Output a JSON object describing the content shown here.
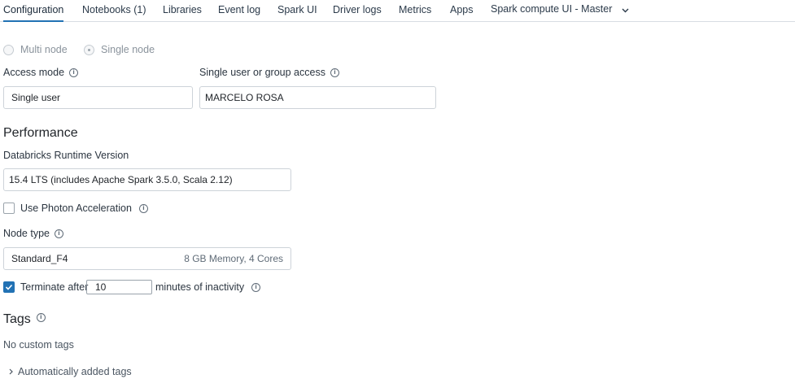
{
  "tabs": [
    {
      "label": "Configuration",
      "active": true
    },
    {
      "label": "Notebooks (1)"
    },
    {
      "label": "Libraries"
    },
    {
      "label": "Event log"
    },
    {
      "label": "Spark UI"
    },
    {
      "label": "Driver logs"
    },
    {
      "label": "Metrics"
    },
    {
      "label": "Apps"
    },
    {
      "label": "Spark compute UI - Master"
    }
  ],
  "node_mode": {
    "options": [
      "Multi node",
      "Single node"
    ],
    "selected": "Single node"
  },
  "access_mode": {
    "label": "Access mode",
    "value": "Single user"
  },
  "user_access": {
    "label": "Single user or group access",
    "value": "MARCELO ROSA"
  },
  "performance": {
    "title": "Performance",
    "runtime_label": "Databricks Runtime Version",
    "runtime_value": "15.4 LTS (includes Apache Spark 3.5.0, Scala 2.12)",
    "photon_label": "Use Photon Acceleration",
    "photon_checked": false,
    "node_type_label": "Node type",
    "node_type_value": "Standard_F4",
    "node_type_spec": "8 GB Memory, 4 Cores",
    "terminate_label": "Terminate after",
    "terminate_checked": true,
    "terminate_minutes": "10",
    "terminate_suffix": "minutes of inactivity"
  },
  "tags": {
    "title": "Tags",
    "empty_text": "No custom tags",
    "auto_tags_label": "Automatically added tags"
  },
  "colors": {
    "accent": "#2272b4",
    "border": "#cdd3d9"
  }
}
